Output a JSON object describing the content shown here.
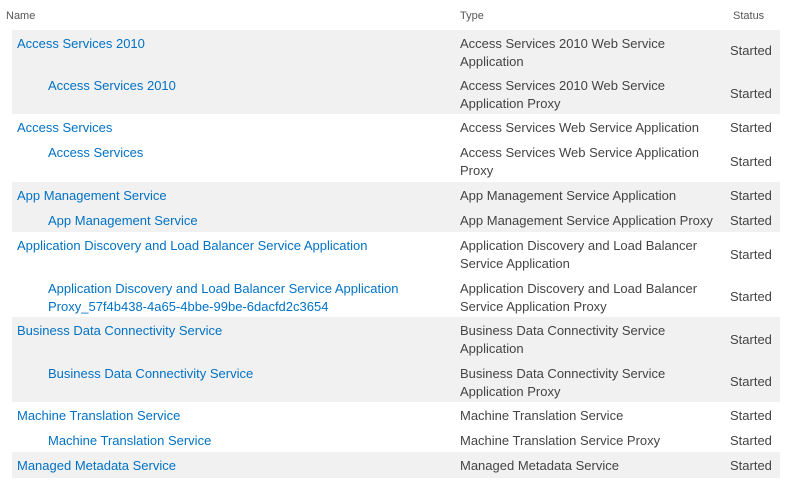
{
  "columns": {
    "name": "Name",
    "type": "Type",
    "status": "Status"
  },
  "rows": [
    {
      "name": "Access Services 2010",
      "type": "Access Services 2010 Web Service Application",
      "status": "Started",
      "child": false
    },
    {
      "name": "Access Services 2010",
      "type": "Access Services 2010 Web Service Application Proxy",
      "status": "Started",
      "child": true
    },
    {
      "name": "Access Services",
      "type": "Access Services Web Service Application",
      "status": "Started",
      "child": false
    },
    {
      "name": "Access Services",
      "type": "Access Services Web Service Application Proxy",
      "status": "Started",
      "child": true
    },
    {
      "name": "App Management Service",
      "type": "App Management Service Application",
      "status": "Started",
      "child": false
    },
    {
      "name": "App Management Service",
      "type": "App Management Service Application Proxy",
      "status": "Started",
      "child": true
    },
    {
      "name": "Application Discovery and Load Balancer Service Application",
      "type": "Application Discovery and Load Balancer Service Application",
      "status": "Started",
      "child": false
    },
    {
      "name": "Application Discovery and Load Balancer Service Application Proxy_57f4b438-4a65-4bbe-99be-6dacfd2c3654",
      "type": "Application Discovery and Load Balancer Service Application Proxy",
      "status": "Started",
      "child": true
    },
    {
      "name": "Business Data Connectivity Service",
      "type": "Business Data Connectivity Service Application",
      "status": "Started",
      "child": false
    },
    {
      "name": "Business Data Connectivity Service",
      "type": "Business Data Connectivity Service Application Proxy",
      "status": "Started",
      "child": true
    },
    {
      "name": "Machine Translation Service",
      "type": "Machine Translation Service",
      "status": "Started",
      "child": false
    },
    {
      "name": "Machine Translation Service",
      "type": "Machine Translation Service Proxy",
      "status": "Started",
      "child": true
    },
    {
      "name": "Managed Metadata Service",
      "type": "Managed Metadata Service",
      "status": "Started",
      "child": false
    }
  ]
}
